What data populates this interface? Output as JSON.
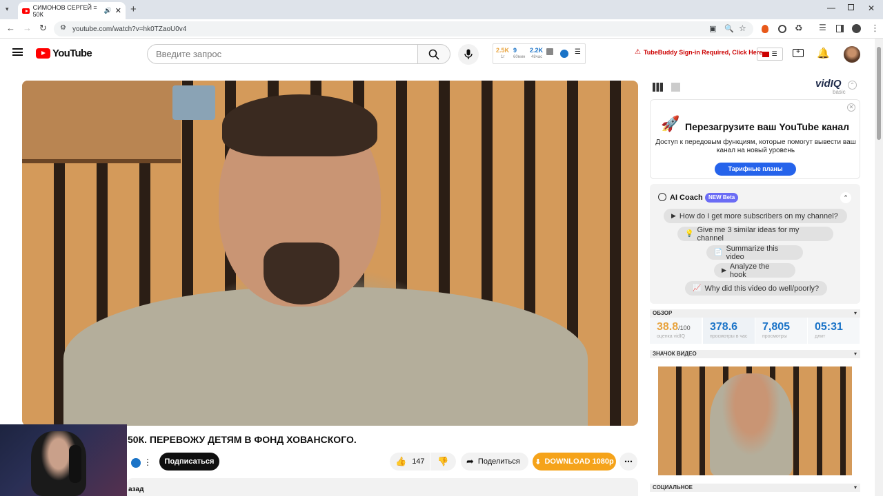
{
  "browser": {
    "tab_title": "СИМОНОВ СЕРГЕЙ = 50К",
    "url": "youtube.com/watch?v=hk0TZaoU0v4"
  },
  "header": {
    "logo_text": "YouTube",
    "search_placeholder": "Введите запрос",
    "stats": {
      "subs": "2.5K",
      "subs_sub": "1г",
      "views_small": "9",
      "views_small_sub": "60мин",
      "views_48": "2.2K",
      "views_48_sub": "48час"
    },
    "tubebuddy_warning": "TubeBuddy Sign-in Required, Click Here"
  },
  "video": {
    "title": "50К. ПЕРЕВОЖУ ДЕТЯМ В ФОНД ХОВАНСКОГО.",
    "subscribe_label": "Подписаться",
    "likes": "147",
    "share_label": "Поделиться",
    "download_label": "DOWNLOAD 1080p",
    "description_prefix": "азад"
  },
  "vidiq": {
    "logo": "vidIQ",
    "plan": "basic",
    "promo_title": "Перезагрузите ваш YouTube канал",
    "promo_text": "Доступ к передовым функциям, которые помогут вывести ваш канал на новый уровень",
    "promo_button": "Тарифные планы",
    "coach_title": "AI Coach",
    "coach_badge": "NEW Beta",
    "coach_questions": [
      "How do I get more subscribers on my channel?",
      "Give me 3 similar ideas for my channel",
      "Summarize this video",
      "Analyze the hook",
      "Why did this video do well/poorly?"
    ],
    "overview_label": "ОБЗОР",
    "score": "38.8",
    "score_max": "/100",
    "score_label": "оценка vidIQ",
    "vph": "378.6",
    "vph_label": "просмотры в час",
    "views": "7,805",
    "views_label": "просмотры",
    "duration": "05:31",
    "duration_label": "длит",
    "thumbnail_label": "ЗНАЧОК ВИДЕО",
    "social_label": "СОЦИАЛЬНОЕ"
  },
  "colors": {
    "youtube_red": "#ff0000",
    "vidiq_blue": "#1a73c7",
    "promo_button": "#2563eb",
    "coach_badge": "#6b6cf5",
    "download": "#f5a31a",
    "score": "#e8a33d"
  }
}
